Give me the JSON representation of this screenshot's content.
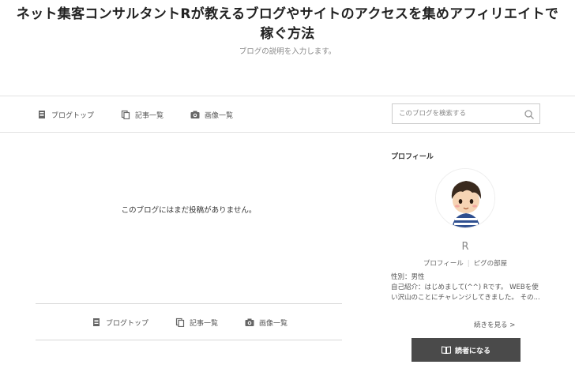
{
  "header": {
    "title": "ネット集客コンサルタントRが教えるブログやサイトのアクセスを集めアフィリエイトで稼ぐ方法",
    "description": "ブログの説明を入力します。"
  },
  "nav": {
    "blog_top": "ブログトップ",
    "articles": "記事一覧",
    "images": "画像一覧"
  },
  "search": {
    "placeholder": "このブログを検索する"
  },
  "main": {
    "empty_message": "このブログにはまだ投稿がありません。"
  },
  "sidebar": {
    "heading": "プロフィール",
    "name": "R",
    "link_profile": "プロフィール",
    "link_room": "ピグの部屋",
    "gender": "性別：男性",
    "intro": "自己紹介：はじめまして(^^) Rです。 WEBを使い沢山のことにチャレンジしてきました。 その...",
    "read_more": "続きを見る >",
    "subscribe": "読者になる"
  },
  "icons": {
    "blog_top": "document-icon",
    "articles": "copy-icon",
    "images": "camera-icon",
    "search": "search-icon",
    "subscribe": "book-icon"
  }
}
